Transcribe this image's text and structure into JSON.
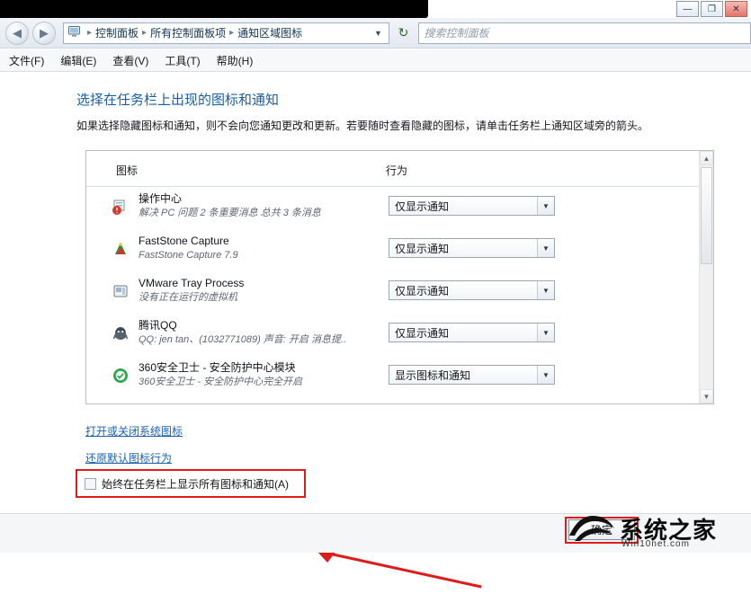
{
  "window": {
    "buttons": {
      "minimize": "—",
      "maximize": "❐",
      "close": "✕"
    }
  },
  "addressbar": {
    "back_icon": "◀",
    "forward_icon": "▶",
    "monitor_icon": "computer-icon",
    "crumbs": [
      "控制面板",
      "所有控制面板项",
      "通知区域图标"
    ],
    "separator": "▸",
    "dropdown_icon": "▼",
    "refresh_icon": "↻",
    "search_placeholder": "搜索控制面板"
  },
  "menubar": {
    "items": [
      "文件(F)",
      "编辑(E)",
      "查看(V)",
      "工具(T)",
      "帮助(H)"
    ]
  },
  "page": {
    "title": "选择在任务栏上出现的图标和通知",
    "description": "如果选择隐藏图标和通知，则不会向您通知更改和更新。若要随时查看隐藏的图标，请单击任务栏上通知区域旁的箭头。"
  },
  "table": {
    "headers": {
      "icons": "图标",
      "behaviors": "行为"
    },
    "rows": [
      {
        "icon": "action-center-icon",
        "name": "操作中心",
        "sub": "解决 PC 问题  2 条重要消息  总共 3 条消息",
        "behavior": "仅显示通知"
      },
      {
        "icon": "faststone-capture-icon",
        "name": "FastStone Capture",
        "sub": "FastStone Capture 7.9",
        "behavior": "仅显示通知"
      },
      {
        "icon": "vmware-tray-icon",
        "name": "VMware Tray Process",
        "sub": "没有正在运行的虚拟机",
        "behavior": "仅显示通知"
      },
      {
        "icon": "tencent-qq-icon",
        "name": "腾讯QQ",
        "sub": "QQ: jen tan、(1032771089)  声音: 开启  消息提..",
        "behavior": "仅显示通知"
      },
      {
        "icon": "360-safe-icon",
        "name": "360安全卫士 - 安全防护中心模块",
        "sub": "360安全卫士 - 安全防护中心完全开启",
        "behavior": "显示图标和通知"
      }
    ],
    "combo_arrow": "▼"
  },
  "links": {
    "system_icons": "打开或关闭系统图标",
    "restore_defaults": "还原默认图标行为"
  },
  "checkbox": {
    "label": "始终在任务栏上显示所有图标和通知(A)",
    "checked": false
  },
  "footer": {
    "ok_label": "确定"
  },
  "watermark": {
    "title": "系统之家",
    "subtitle": "Win10net.com"
  },
  "scrollbar": {
    "up_icon": "▲",
    "down_icon": "▼"
  },
  "colors": {
    "accent_link": "#1b63b0",
    "title_blue": "#1b5ea8",
    "highlight_red": "#e01b1b"
  }
}
